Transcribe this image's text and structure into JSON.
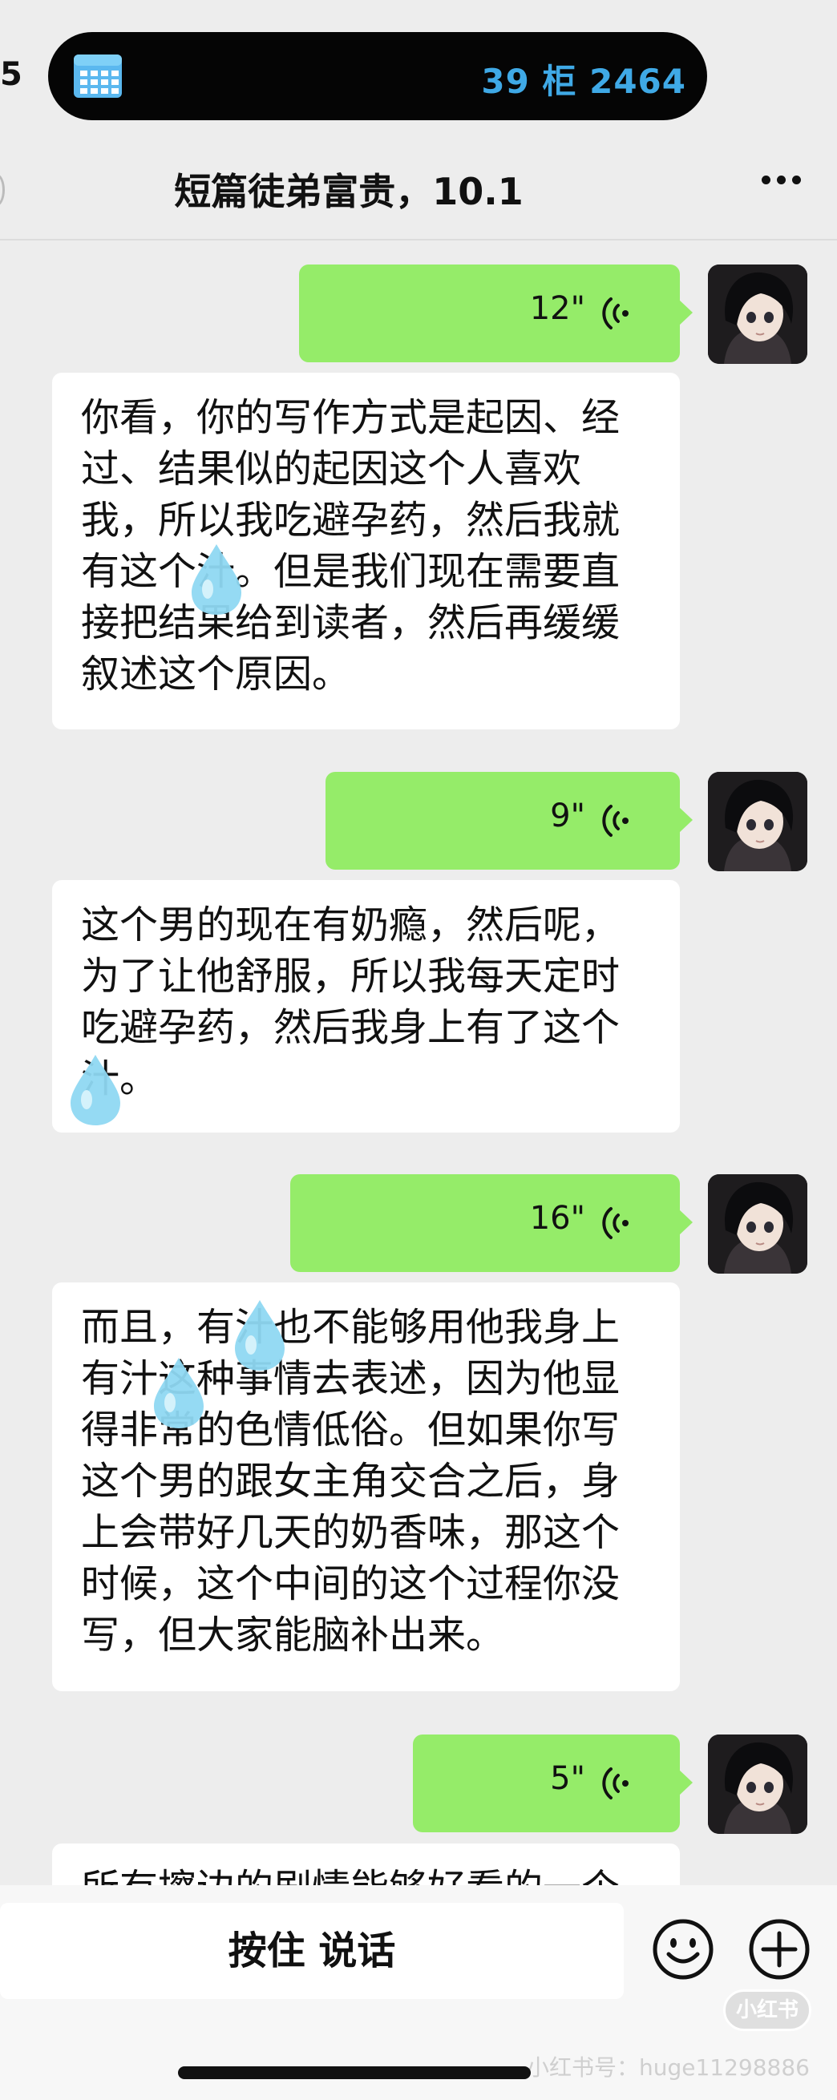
{
  "status_bar": {
    "left_text": "5",
    "island_text": "39 柜 2464",
    "island_icon": "card-icon"
  },
  "nav": {
    "title": "短篇徒弟富贵，10.1",
    "more_icon": "more-icon"
  },
  "messages": [
    {
      "type": "voice",
      "side": "right",
      "duration": "12\""
    },
    {
      "type": "text",
      "side": "left",
      "text": "你看，你的写作方式是起因、经过、结果似的起因这个人喜欢我，所以我吃避孕药，然后我就有这个汁。但是我们现在需要直接把结果给到读者，然后再缓缓叙述这个原因。"
    },
    {
      "type": "voice",
      "side": "right",
      "duration": "9\""
    },
    {
      "type": "text",
      "side": "left",
      "text": "这个男的现在有奶瘾，然后呢，为了让他舒服，所以我每天定时吃避孕药，然后我身上有了这个汁。"
    },
    {
      "type": "voice",
      "side": "right",
      "duration": "16\""
    },
    {
      "type": "text",
      "side": "left",
      "text": "而且，有汁也不能够用他我身上有汁这种事情去表述，因为他显得非常的色情低俗。但如果你写这个男的跟女主角交合之后，身上会带好几天的奶香味，那这个时候，这个中间的这个过程你没写，但大家能脑补出来。"
    },
    {
      "type": "voice",
      "side": "right",
      "duration": "5\""
    },
    {
      "type": "text",
      "side": "left",
      "text": "所有擦边的剧情能够好看的一个"
    }
  ],
  "input_bar": {
    "hold_to_talk": "按住 说话",
    "emoji_icon": "emoji-icon",
    "plus_icon": "plus-icon"
  },
  "watermark": {
    "logo": "小红书",
    "text": "小红书号：huge11298886"
  },
  "colors": {
    "background": "#ededed",
    "my_bubble": "#95ec69",
    "their_bubble": "#ffffff",
    "island_text": "#3fa9e6"
  }
}
